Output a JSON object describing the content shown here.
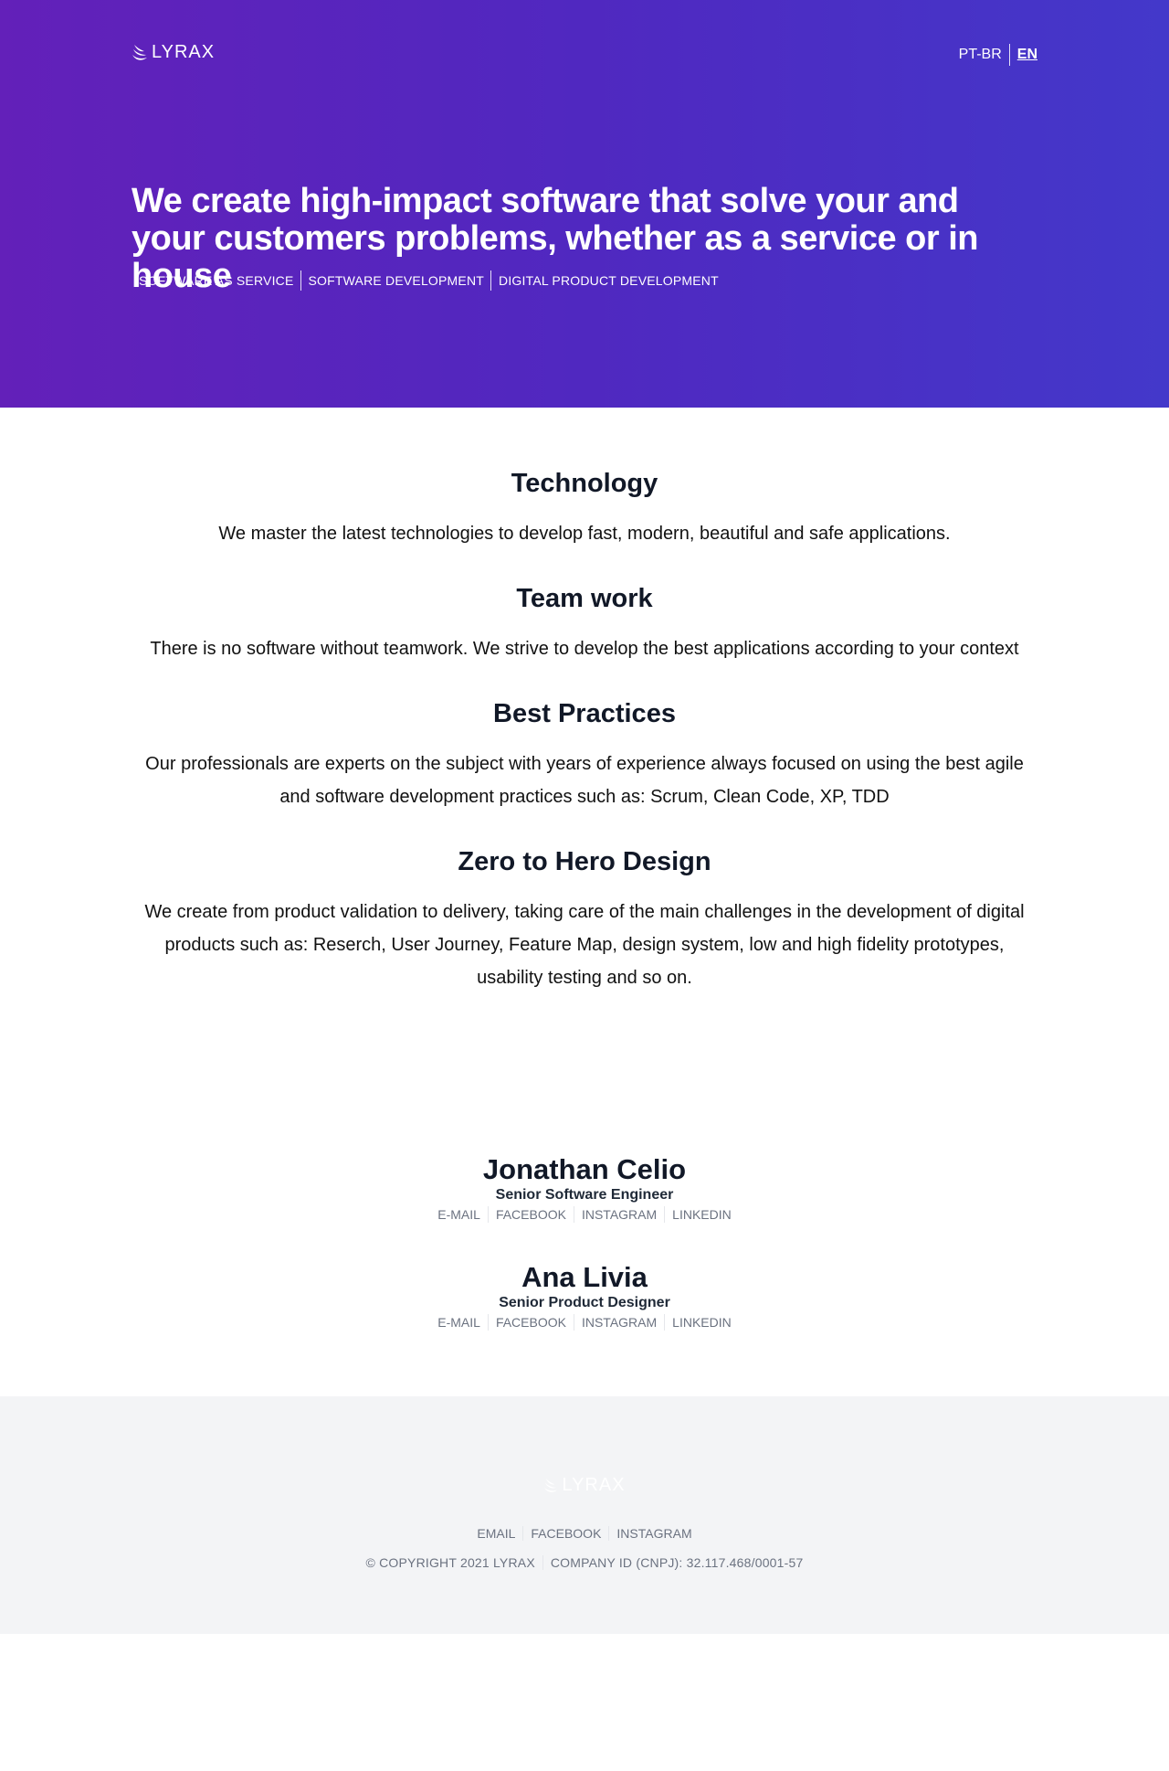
{
  "header": {
    "logo_text": "LYRAX",
    "languages": [
      {
        "label": "PT-BR",
        "active": false
      },
      {
        "label": "EN",
        "active": true
      }
    ]
  },
  "hero": {
    "headline": "We create high-impact software that solve your and your customers problems, whether as a service or in house",
    "tags": [
      "SOFTWARE AS SERVICE",
      "SOFTWARE DEVELOPMENT",
      "DIGITAL PRODUCT DEVELOPMENT"
    ]
  },
  "features": [
    {
      "title": "Technology",
      "text": "We master the latest technologies to develop fast, modern, beautiful and safe applications."
    },
    {
      "title": "Team work",
      "text": "There is no software without teamwork. We strive to develop the best applications according to your context"
    },
    {
      "title": "Best Practices",
      "text": "Our professionals are experts on the subject with years of experience always focused on using the best agile and software development practices such as: Scrum, Clean Code, XP, TDD"
    },
    {
      "title": "Zero to Hero Design",
      "text": "We create from product validation to delivery, taking care of the main challenges in the development of digital products such as: Reserch, User Journey, Feature Map, design system, low and high fidelity prototypes, usability testing and so on."
    }
  ],
  "team": [
    {
      "name": "Jonathan Celio",
      "role": "Senior Software Engineer",
      "links": [
        "E-MAIL",
        "FACEBOOK",
        "INSTAGRAM",
        "LINKEDIN"
      ]
    },
    {
      "name": "Ana Livia",
      "role": "Senior Product Designer",
      "links": [
        "E-MAIL",
        "FACEBOOK",
        "INSTAGRAM",
        "LINKEDIN"
      ]
    }
  ],
  "footer": {
    "logo_text": "LYRAX",
    "links": [
      "EMAIL",
      "FACEBOOK",
      "INSTAGRAM"
    ],
    "copyright": "© COPYRIGHT 2021 LYRAX",
    "company_id": "COMPANY ID (CNPJ): 32.117.468/0001-57"
  },
  "colors": {
    "hero_gradient_start": "#6320b9",
    "hero_gradient_end": "#4338ca",
    "footer_bg": "#f3f4f6"
  }
}
